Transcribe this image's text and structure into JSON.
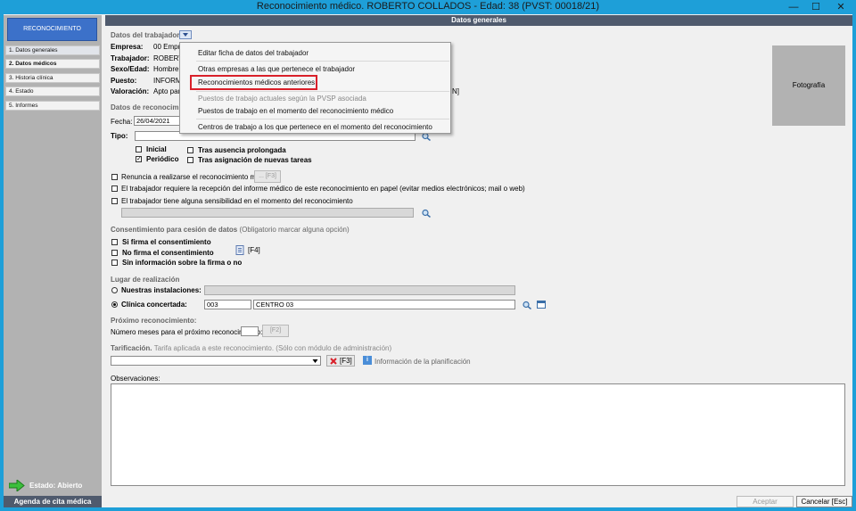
{
  "window": {
    "title": "Reconocimiento médico. ROBERTO COLLADOS  -  Edad: 38   (PVST: 00018/21)",
    "minimize": "—",
    "maximize": "☐",
    "close": "✕"
  },
  "sidebar": {
    "header_button": "RECONOCIMIENTO",
    "items": [
      {
        "label": "1. Datos generales"
      },
      {
        "label": "2. Datos médicos"
      },
      {
        "label": "3. Historia clínica"
      },
      {
        "label": "4. Estado"
      },
      {
        "label": "5. Informes"
      }
    ],
    "estado": "Estado: Abierto",
    "agenda": "Agenda de cita médica"
  },
  "main": {
    "header": "Datos generales",
    "datos_trabajador": {
      "title": "Datos del trabajador",
      "empresa_label": "Empresa:",
      "empresa_value": "00 Empre",
      "trabajador_label": "Trabajador:",
      "trabajador_value": "ROBERT",
      "sexo_label": "Sexo/Edad:",
      "sexo_value": "Hombre 3",
      "puesto_label": "Puesto:",
      "puesto_value": "INFORM",
      "valoracion_label": "Valoración:",
      "valoracion_value": "Apto para",
      "valoracion_suffix": "N]"
    },
    "datos_reconocimiento": {
      "title": "Datos de reconocimie",
      "fecha_label": "Fecha:",
      "fecha_value": "26/04/2021",
      "tipo_label": "Tipo:",
      "inicial": "Inicial",
      "periodico": "Periódico",
      "tras_ausencia": "Tras ausencia prolongada",
      "tras_asignacion": "Tras asignación de nuevas tareas",
      "check_mark": "✓"
    },
    "renuncia": "Renuncia a realizarse el reconocimiento médico",
    "renuncia_btn": "... [F3]",
    "recepcion": "El trabajador requiere la recepción del informe médico de este reconocimiento en papel (evitar medios electrónicos; mail o web)",
    "sensibilidad": "El trabajador tiene alguna sensibilidad en el momento del reconocimiento",
    "consentimiento": {
      "title": "Consentimiento para cesión de datos",
      "note": "(Obligatorio marcar alguna opción)",
      "si": "Si firma el consentimiento",
      "no": "No firma el consentimiento",
      "sin": "Sin información sobre la firma o no",
      "f4": "[F4]"
    },
    "lugar": {
      "title": "Lugar de realización",
      "nuestras": "Nuestras instalaciones:",
      "clinica": "Clínica concertada:",
      "clinica_code": "003",
      "clinica_name": "CENTRO 03"
    },
    "proximo": {
      "title": "Próximo reconocimiento:",
      "meses_label": "Número meses para el próximo reconocimiento:",
      "f2": "[F2]"
    },
    "tarificacion": {
      "title": "Tarificación.",
      "note": "Tarifa aplicada a este reconocimiento. (Sólo con módulo de administración)",
      "f3": "[F3]",
      "info": "Información de la planificación"
    },
    "observaciones_label": "Observaciones:",
    "fotografia": "Fotografía"
  },
  "context_menu": {
    "items": [
      {
        "label": "Editar ficha de datos del trabajador",
        "enabled": true
      },
      {
        "label": "Otras empresas a las que pertenece el trabajador",
        "enabled": true
      },
      {
        "label": "Reconocimientos médicos anteriores",
        "enabled": true
      },
      {
        "label": "Puestos de trabajo actuales según la PVSP asociada",
        "enabled": false
      },
      {
        "label": "Puestos de trabajo en el momento del reconocimiento médico",
        "enabled": true
      },
      {
        "label": "Centros de trabajo a los que pertenece en el momento del reconocimiento",
        "enabled": true
      }
    ]
  },
  "footer": {
    "aceptar": "Aceptar",
    "cancelar": "Cancelar [Esc]"
  },
  "colors": {
    "titlebar": "#1e9fd8",
    "header_dark": "#4f5a6d",
    "accent_blue": "#3c71c9",
    "highlight_red": "#d9202a"
  }
}
